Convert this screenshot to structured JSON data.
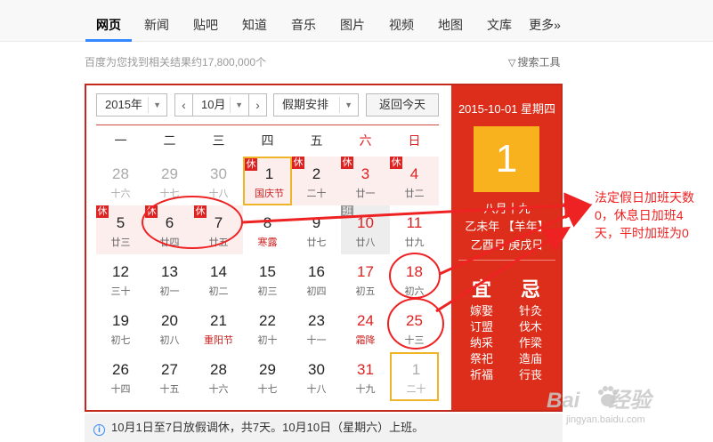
{
  "nav": {
    "tabs": [
      {
        "label": "网页",
        "active": true
      },
      {
        "label": "新闻"
      },
      {
        "label": "贴吧"
      },
      {
        "label": "知道"
      },
      {
        "label": "音乐"
      },
      {
        "label": "图片"
      },
      {
        "label": "视频"
      },
      {
        "label": "地图"
      },
      {
        "label": "文库"
      },
      {
        "label": "更多»"
      }
    ]
  },
  "results": {
    "count_text": "百度为您找到相关结果约17,800,000个",
    "tools_label": "搜索工具"
  },
  "calendar": {
    "year_select": "2015年",
    "month_select": "10月",
    "holiday_select": "假期安排",
    "today_button": "返回今天",
    "prev_arrow": "‹",
    "next_arrow": "›",
    "weekdays": [
      "一",
      "二",
      "三",
      "四",
      "五",
      "六",
      "日"
    ],
    "weeks": [
      [
        {
          "d": "28",
          "l": "十六",
          "faded": true
        },
        {
          "d": "29",
          "l": "十七",
          "faded": true
        },
        {
          "d": "30",
          "l": "十八",
          "faded": true
        },
        {
          "d": "1",
          "l": "国庆节",
          "festival": true,
          "tag": "休",
          "hol": true,
          "selected": true
        },
        {
          "d": "2",
          "l": "二十",
          "tag": "休",
          "hol": true
        },
        {
          "d": "3",
          "l": "廿一",
          "tag": "休",
          "hol": true
        },
        {
          "d": "4",
          "l": "廿二",
          "tag": "休",
          "hol": true
        }
      ],
      [
        {
          "d": "5",
          "l": "廿三",
          "tag": "休",
          "hol": true
        },
        {
          "d": "6",
          "l": "廿四",
          "tag": "休",
          "hol": true
        },
        {
          "d": "7",
          "l": "廿五",
          "tag": "休",
          "hol": true
        },
        {
          "d": "8",
          "l": "寒露",
          "festival": true
        },
        {
          "d": "9",
          "l": "廿七"
        },
        {
          "d": "10",
          "l": "廿八",
          "tag": "班",
          "work": true
        },
        {
          "d": "11",
          "l": "廿九"
        }
      ],
      [
        {
          "d": "12",
          "l": "三十"
        },
        {
          "d": "13",
          "l": "初一"
        },
        {
          "d": "14",
          "l": "初二"
        },
        {
          "d": "15",
          "l": "初三"
        },
        {
          "d": "16",
          "l": "初四"
        },
        {
          "d": "17",
          "l": "初五"
        },
        {
          "d": "18",
          "l": "初六"
        }
      ],
      [
        {
          "d": "19",
          "l": "初七"
        },
        {
          "d": "20",
          "l": "初八"
        },
        {
          "d": "21",
          "l": "重阳节",
          "festival": true
        },
        {
          "d": "22",
          "l": "初十"
        },
        {
          "d": "23",
          "l": "十一"
        },
        {
          "d": "24",
          "l": "霜降",
          "festival": true
        },
        {
          "d": "25",
          "l": "十三"
        }
      ],
      [
        {
          "d": "26",
          "l": "十四"
        },
        {
          "d": "27",
          "l": "十五"
        },
        {
          "d": "28",
          "l": "十六"
        },
        {
          "d": "29",
          "l": "十七"
        },
        {
          "d": "30",
          "l": "十八"
        },
        {
          "d": "31",
          "l": "十九"
        },
        {
          "d": "1",
          "l": "二十",
          "faded": true,
          "today": true
        }
      ]
    ],
    "detail": {
      "date": "2015-10-01 星期四",
      "big_day": "1",
      "lunar": "八月十九",
      "ganzhi_line1": "乙未年 【羊年】",
      "ganzhi_line2": "乙酉月 庚戌日",
      "yi_label": "宜",
      "ji_label": "忌",
      "yi_items": [
        "嫁娶",
        "订盟",
        "纳采",
        "祭祀",
        "祈福"
      ],
      "ji_items": [
        "针灸",
        "伐木",
        "作梁",
        "造庙",
        "行丧"
      ]
    }
  },
  "notice": {
    "text": "10月1日至7日放假调休，共7天。10月10日（星期六）上班。"
  },
  "annotation": {
    "line1": "法定假日加班天数",
    "line2": "0，休息日加班4",
    "line3": "天，平时加班为0"
  },
  "watermark": {
    "text_a": "Bai",
    "text_a2": "经验",
    "text_b": "jingyan.baidu.com"
  },
  "colors": {
    "accent_red": "#dc2e1a",
    "today_yellow": "#f7b21e",
    "annotation_red": "#e22"
  }
}
